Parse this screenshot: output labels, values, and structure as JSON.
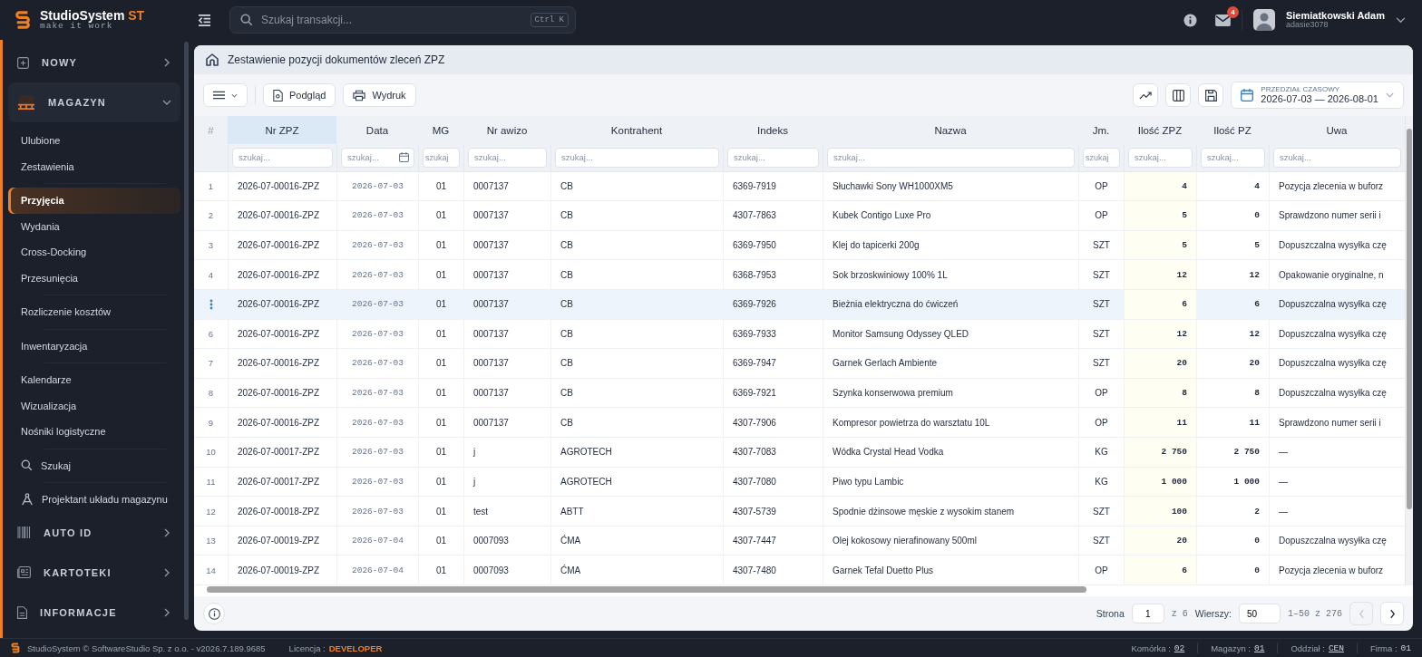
{
  "app": {
    "name": "StudioSystem",
    "name_suffix": "ST",
    "tagline": "make it work"
  },
  "search": {
    "placeholder": "Szukaj transakcji...",
    "shortcut": "Ctrl K"
  },
  "user": {
    "name": "Siemiatkowski Adam",
    "login": "adasie3078",
    "mail_badge": "4"
  },
  "sidebar": {
    "groups": [
      {
        "label": "NOWY",
        "kind": "plus",
        "expanded": false
      },
      {
        "label": "MAGAZYN",
        "kind": "pallet",
        "expanded": true,
        "sections": [
          [
            {
              "label": "Ulubione",
              "kind": "plain",
              "selected": false
            },
            {
              "label": "Zestawienia",
              "kind": "plain",
              "selected": false
            }
          ],
          [
            {
              "label": "Przyjęcia",
              "kind": "plain",
              "selected": true
            },
            {
              "label": "Wydania",
              "kind": "plain",
              "selected": false
            },
            {
              "label": "Cross-Docking",
              "kind": "plain",
              "selected": false
            },
            {
              "label": "Przesunięcia",
              "kind": "plain",
              "selected": false
            }
          ],
          [
            {
              "label": "Rozliczenie kosztów",
              "kind": "plain",
              "selected": false
            }
          ],
          [
            {
              "label": "Inwentaryzacja",
              "kind": "plain",
              "selected": false
            }
          ],
          [
            {
              "label": "Kalendarze",
              "kind": "plain",
              "selected": false
            },
            {
              "label": "Wizualizacja",
              "kind": "plain",
              "selected": false
            },
            {
              "label": "Nośniki logistyczne",
              "kind": "plain",
              "selected": false
            }
          ],
          [
            {
              "label": "Szukaj",
              "kind": "search",
              "selected": false
            }
          ],
          [
            {
              "label": "Projektant układu magazynu",
              "kind": "designer",
              "selected": false
            }
          ]
        ]
      },
      {
        "label": "AUTO ID",
        "kind": "barcode",
        "expanded": false
      },
      {
        "label": "KARTOTEKI",
        "kind": "cards",
        "expanded": false
      },
      {
        "label": "INFORMACJE",
        "kind": "document",
        "expanded": false
      }
    ]
  },
  "page": {
    "title": "Zestawienie pozycji dokumentów zleceń ZPZ"
  },
  "toolbar": {
    "buttons": [
      "Podgląd",
      "Wydruk"
    ],
    "range_label": "PRZEDZIAŁ CZASOWY",
    "range_value": "2026-07-03 — 2026-08-01"
  },
  "table": {
    "corner": "#",
    "columns": [
      {
        "label": "Nr ZPZ",
        "selected": true,
        "placeholder": "szukaj...",
        "kind": "text"
      },
      {
        "label": "Data",
        "selected": false,
        "placeholder": "szukaj...",
        "kind": "date"
      },
      {
        "label": "MG",
        "selected": false,
        "placeholder": "szukaj",
        "kind": "center"
      },
      {
        "label": "Nr awizo",
        "selected": false,
        "placeholder": "szukaj...",
        "kind": "text"
      },
      {
        "label": "Kontrahent",
        "selected": false,
        "placeholder": "szukaj...",
        "kind": "text"
      },
      {
        "label": "Indeks",
        "selected": false,
        "placeholder": "szukaj...",
        "kind": "text"
      },
      {
        "label": "Nazwa",
        "selected": false,
        "placeholder": "szukaj...",
        "kind": "text"
      },
      {
        "label": "Jm.",
        "selected": false,
        "placeholder": "szukaj",
        "kind": "center"
      },
      {
        "label": "Ilość ZPZ",
        "selected": false,
        "placeholder": "szukaj...",
        "kind": "number"
      },
      {
        "label": "Ilość PZ",
        "selected": false,
        "placeholder": "szukaj...",
        "kind": "number"
      },
      {
        "label": "Uwa",
        "selected": false,
        "placeholder": "szukaj...",
        "kind": "text"
      }
    ],
    "rows": [
      {
        "number": "1",
        "selected": false,
        "cells": [
          "2026-07-00016-ZPZ",
          "2026-07-03",
          "01",
          "0007137",
          "CB",
          "6369-7919",
          "Słuchawki Sony WH1000XM5",
          "OP",
          "4",
          "4",
          "Pozycja zlecenia w buforz"
        ]
      },
      {
        "number": "2",
        "selected": false,
        "cells": [
          "2026-07-00016-ZPZ",
          "2026-07-03",
          "01",
          "0007137",
          "CB",
          "4307-7863",
          "Kubek Contigo Luxe Pro",
          "OP",
          "5",
          "0",
          "Sprawdzono numer serii i"
        ]
      },
      {
        "number": "3",
        "selected": false,
        "cells": [
          "2026-07-00016-ZPZ",
          "2026-07-03",
          "01",
          "0007137",
          "CB",
          "6369-7950",
          "Klej do tapicerki 200g",
          "SZT",
          "5",
          "5",
          "Dopuszczalna wysyłka czę"
        ]
      },
      {
        "number": "4",
        "selected": false,
        "cells": [
          "2026-07-00016-ZPZ",
          "2026-07-03",
          "01",
          "0007137",
          "CB",
          "6368-7953",
          "Sok brzoskwiniowy 100% 1L",
          "SZT",
          "12",
          "12",
          "Opakowanie oryginalne, n"
        ]
      },
      {
        "selected": true,
        "cells": [
          "2026-07-00016-ZPZ",
          "2026-07-03",
          "01",
          "0007137",
          "CB",
          "6369-7926",
          "Bieżnia elektryczna do ćwiczeń",
          "SZT",
          "6",
          "6",
          "Dopuszczalna wysyłka czę"
        ]
      },
      {
        "number": "6",
        "selected": false,
        "cells": [
          "2026-07-00016-ZPZ",
          "2026-07-03",
          "01",
          "0007137",
          "CB",
          "6369-7933",
          "Monitor Samsung Odyssey QLED",
          "SZT",
          "12",
          "12",
          "Dopuszczalna wysyłka czę"
        ]
      },
      {
        "number": "7",
        "selected": false,
        "cells": [
          "2026-07-00016-ZPZ",
          "2026-07-03",
          "01",
          "0007137",
          "CB",
          "6369-7947",
          "Garnek Gerlach Ambiente",
          "SZT",
          "20",
          "20",
          "Dopuszczalna wysyłka czę"
        ]
      },
      {
        "number": "8",
        "selected": false,
        "cells": [
          "2026-07-00016-ZPZ",
          "2026-07-03",
          "01",
          "0007137",
          "CB",
          "6369-7921",
          "Szynka konserwowa premium",
          "OP",
          "8",
          "8",
          "Dopuszczalna wysyłka czę"
        ]
      },
      {
        "number": "9",
        "selected": false,
        "cells": [
          "2026-07-00016-ZPZ",
          "2026-07-03",
          "01",
          "0007137",
          "CB",
          "4307-7906",
          "Kompresor powietrza do warsztatu 10L",
          "OP",
          "11",
          "11",
          "Sprawdzono numer serii i"
        ]
      },
      {
        "number": "10",
        "selected": false,
        "cells": [
          "2026-07-00017-ZPZ",
          "2026-07-03",
          "01",
          "j",
          "AGROTECH",
          "4307-7083",
          "Wódka Crystal Head Vodka",
          "KG",
          "2 750",
          "2 750",
          "—"
        ]
      },
      {
        "number": "11",
        "selected": false,
        "cells": [
          "2026-07-00017-ZPZ",
          "2026-07-03",
          "01",
          "j",
          "AGROTECH",
          "4307-7080",
          "Piwo typu Lambic",
          "KG",
          "1 000",
          "1 000",
          "—"
        ]
      },
      {
        "number": "12",
        "selected": false,
        "cells": [
          "2026-07-00018-ZPZ",
          "2026-07-03",
          "01",
          "test",
          "ABTT",
          "4307-5739",
          "Spodnie dżinsowe męskie z wysokim stanem",
          "SZT",
          "100",
          "2",
          "—"
        ]
      },
      {
        "number": "13",
        "selected": false,
        "cells": [
          "2026-07-00019-ZPZ",
          "2026-07-04",
          "01",
          "0007093",
          "ĆMA",
          "4307-7447",
          "Olej kokosowy nierafinowany 500ml",
          "SZT",
          "20",
          "0",
          "Dopuszczalna wysyłka czę"
        ]
      },
      {
        "number": "14",
        "selected": false,
        "cells": [
          "2026-07-00019-ZPZ",
          "2026-07-04",
          "01",
          "0007093",
          "ĆMA",
          "4307-7480",
          "Garnek Tefal Duetto Plus",
          "OP",
          "6",
          "0",
          "Pozycja zlecenia w buforz"
        ]
      }
    ]
  },
  "pagination": {
    "page_label": "Strona",
    "page": "1",
    "page_total": "z 6",
    "rows_label": "Wierszy:",
    "rows": "50",
    "range": "1–50 z 276",
    "prev_disabled": true,
    "next_disabled": false
  },
  "status_bar": {
    "copyright": "StudioSystem © SoftwareStudio Sp. z o.o. - v2026.7.189.9685",
    "license_label": "Licencja :",
    "license": "DEVELOPER",
    "fields": [
      {
        "label": "Komórka :",
        "value": "02"
      },
      {
        "label": "Magazyn :",
        "value": "01"
      },
      {
        "label": "Oddział :",
        "value": "CEN"
      },
      {
        "label": "Firma :",
        "value": "01"
      }
    ]
  }
}
